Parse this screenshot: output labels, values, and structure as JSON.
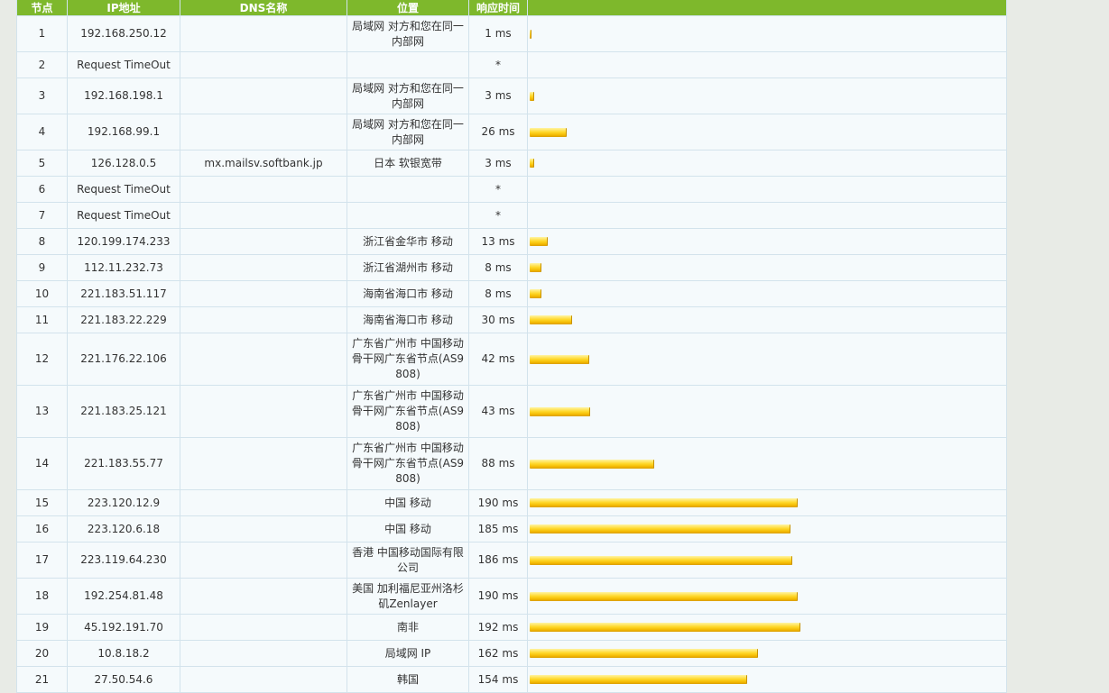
{
  "table": {
    "headers": [
      "节点",
      "IP地址",
      "DNS名称",
      "位置",
      "响应时间",
      ""
    ],
    "rows": [
      {
        "node": "1",
        "ip": "192.168.250.12",
        "dns": "",
        "location": "局域网 对方和您在同一内部网",
        "time": "1 ms",
        "ms": 1,
        "h": 40
      },
      {
        "node": "2",
        "ip": "Request TimeOut",
        "dns": "",
        "location": "",
        "time": "*",
        "ms": 0,
        "h": 29
      },
      {
        "node": "3",
        "ip": "192.168.198.1",
        "dns": "",
        "location": "局域网 对方和您在同一内部网",
        "time": "3 ms",
        "ms": 3,
        "h": 40
      },
      {
        "node": "4",
        "ip": "192.168.99.1",
        "dns": "",
        "location": "局域网 对方和您在同一内部网",
        "time": "26 ms",
        "ms": 26,
        "h": 40
      },
      {
        "node": "5",
        "ip": "126.128.0.5",
        "dns": "mx.mailsv.softbank.jp",
        "location": "日本 软银宽带",
        "time": "3 ms",
        "ms": 3,
        "h": 29
      },
      {
        "node": "6",
        "ip": "Request TimeOut",
        "dns": "",
        "location": "",
        "time": "*",
        "ms": 0,
        "h": 29
      },
      {
        "node": "7",
        "ip": "Request TimeOut",
        "dns": "",
        "location": "",
        "time": "*",
        "ms": 0,
        "h": 29
      },
      {
        "node": "8",
        "ip": "120.199.174.233",
        "dns": "",
        "location": "浙江省金华市 移动",
        "time": "13 ms",
        "ms": 13,
        "h": 29
      },
      {
        "node": "9",
        "ip": "112.11.232.73",
        "dns": "",
        "location": "浙江省湖州市 移动",
        "time": "8 ms",
        "ms": 8,
        "h": 29
      },
      {
        "node": "10",
        "ip": "221.183.51.117",
        "dns": "",
        "location": "海南省海口市 移动",
        "time": "8 ms",
        "ms": 8,
        "h": 29
      },
      {
        "node": "11",
        "ip": "221.183.22.229",
        "dns": "",
        "location": "海南省海口市 移动",
        "time": "30 ms",
        "ms": 30,
        "h": 29
      },
      {
        "node": "12",
        "ip": "221.176.22.106",
        "dns": "",
        "location": "广东省广州市 中国移动骨干网广东省节点(AS9808)",
        "time": "42 ms",
        "ms": 42,
        "h": 58
      },
      {
        "node": "13",
        "ip": "221.183.25.121",
        "dns": "",
        "location": "广东省广州市 中国移动骨干网广东省节点(AS9808)",
        "time": "43 ms",
        "ms": 43,
        "h": 58
      },
      {
        "node": "14",
        "ip": "221.183.55.77",
        "dns": "",
        "location": "广东省广州市 中国移动骨干网广东省节点(AS9808)",
        "time": "88 ms",
        "ms": 88,
        "h": 58
      },
      {
        "node": "15",
        "ip": "223.120.12.9",
        "dns": "",
        "location": "中国 移动",
        "time": "190 ms",
        "ms": 190,
        "h": 29
      },
      {
        "node": "16",
        "ip": "223.120.6.18",
        "dns": "",
        "location": "中国 移动",
        "time": "185 ms",
        "ms": 185,
        "h": 29
      },
      {
        "node": "17",
        "ip": "223.119.64.230",
        "dns": "",
        "location": "香港 中国移动国际有限公司",
        "time": "186 ms",
        "ms": 186,
        "h": 40
      },
      {
        "node": "18",
        "ip": "192.254.81.48",
        "dns": "",
        "location": "美国 加利福尼亚州洛杉矶Zenlayer",
        "time": "190 ms",
        "ms": 190,
        "h": 40
      },
      {
        "node": "19",
        "ip": "45.192.191.70",
        "dns": "",
        "location": "南非",
        "time": "192 ms",
        "ms": 192,
        "h": 29
      },
      {
        "node": "20",
        "ip": "10.8.18.2",
        "dns": "",
        "location": "局域网 IP",
        "time": "162 ms",
        "ms": 162,
        "h": 29
      },
      {
        "node": "21",
        "ip": "27.50.54.6",
        "dns": "",
        "location": "韩国",
        "time": "154 ms",
        "ms": 154,
        "h": 29
      }
    ]
  },
  "colors": {
    "header_bg": "#7eb82c",
    "bar": "#ffd82a",
    "row_bg": "#f5fafc"
  }
}
